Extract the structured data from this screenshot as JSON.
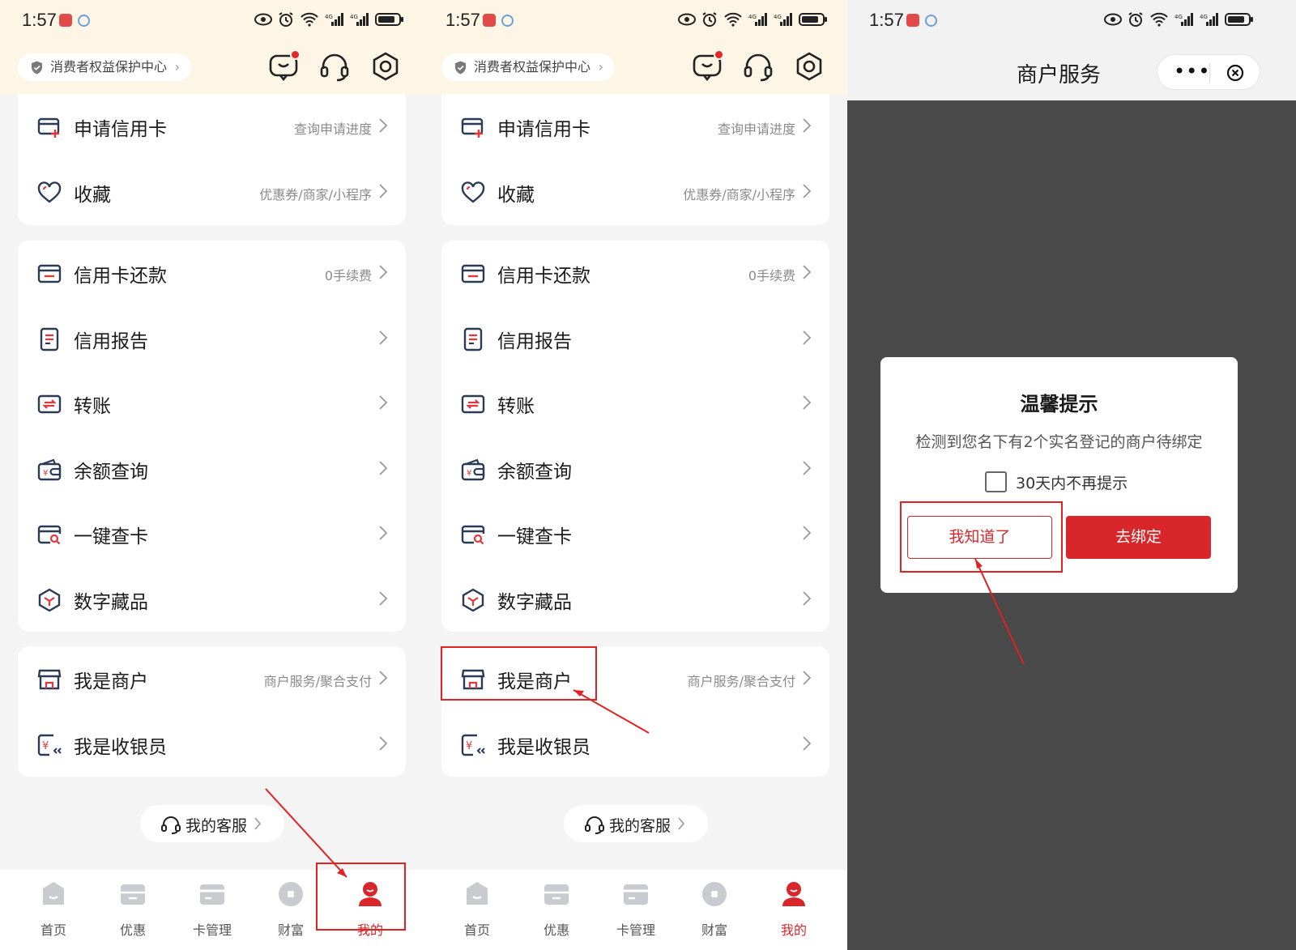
{
  "status_bar": {
    "time": "1:57"
  },
  "panels": [
    {
      "header": {
        "consumer_center": "消费者权益保护中心"
      },
      "card1": [
        {
          "label": "申请信用卡",
          "sub": "查询申请进度",
          "icon": "credit-card-plus-icon"
        },
        {
          "label": "收藏",
          "sub": "优惠券/商家/小程序",
          "icon": "heart-icon"
        }
      ],
      "card2": [
        {
          "label": "信用卡还款",
          "sub": "0手续费",
          "icon": "card-repay-icon"
        },
        {
          "label": "信用报告",
          "sub": "",
          "icon": "document-icon"
        },
        {
          "label": "转账",
          "sub": "",
          "icon": "transfer-icon"
        },
        {
          "label": "余额查询",
          "sub": "",
          "icon": "wallet-icon"
        },
        {
          "label": "一键查卡",
          "sub": "",
          "icon": "card-search-icon"
        },
        {
          "label": "数字藏品",
          "sub": "",
          "icon": "cube-icon"
        }
      ],
      "card3": [
        {
          "label": "我是商户",
          "sub": "商户服务/聚合支付",
          "icon": "shop-icon"
        },
        {
          "label": "我是收银员",
          "sub": "",
          "icon": "cashier-icon"
        }
      ],
      "service": "我的客服",
      "tabs": [
        "首页",
        "优惠",
        "卡管理",
        "财富",
        "我的"
      ]
    },
    {
      "header": {
        "consumer_center": "消费者权益保护中心"
      },
      "card1": [
        {
          "label": "申请信用卡",
          "sub": "查询申请进度",
          "icon": "credit-card-plus-icon"
        },
        {
          "label": "收藏",
          "sub": "优惠券/商家/小程序",
          "icon": "heart-icon"
        }
      ],
      "card2": [
        {
          "label": "信用卡还款",
          "sub": "0手续费",
          "icon": "card-repay-icon"
        },
        {
          "label": "信用报告",
          "sub": "",
          "icon": "document-icon"
        },
        {
          "label": "转账",
          "sub": "",
          "icon": "transfer-icon"
        },
        {
          "label": "余额查询",
          "sub": "",
          "icon": "wallet-icon"
        },
        {
          "label": "一键查卡",
          "sub": "",
          "icon": "card-search-icon"
        },
        {
          "label": "数字藏品",
          "sub": "",
          "icon": "cube-icon"
        }
      ],
      "card3": [
        {
          "label": "我是商户",
          "sub": "商户服务/聚合支付",
          "icon": "shop-icon"
        },
        {
          "label": "我是收银员",
          "sub": "",
          "icon": "cashier-icon"
        }
      ],
      "service": "我的客服",
      "tabs": [
        "首页",
        "优惠",
        "卡管理",
        "财富",
        "我的"
      ]
    }
  ],
  "merchant": {
    "title": "商户服务",
    "dialog": {
      "title": "温馨提示",
      "message": "检测到您名下有2个实名登记的商户待绑定",
      "checkbox_label": "30天内不再提示",
      "checkbox_checked": false,
      "btn_cancel": "我知道了",
      "btn_confirm": "去绑定"
    }
  },
  "colors": {
    "accent": "#d8262a",
    "header_bg": "#fdf5e6",
    "page_bg": "#f4f4f5",
    "overlay": "#4a4a4a",
    "annotation": "#e02222"
  }
}
